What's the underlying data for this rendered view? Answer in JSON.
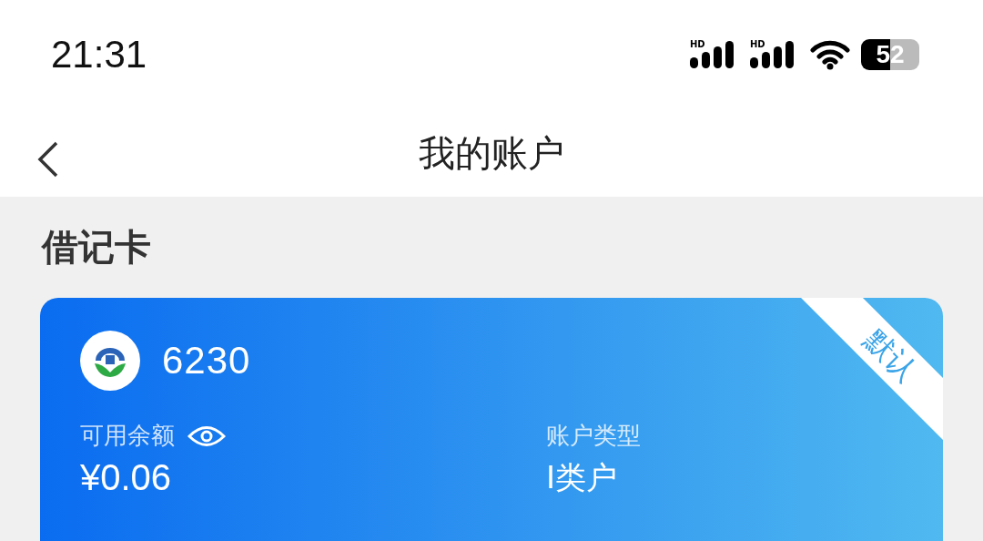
{
  "status_bar": {
    "time": "21:31",
    "signals": [
      {
        "label": "HD"
      },
      {
        "label": "HD"
      }
    ],
    "battery": "52"
  },
  "nav": {
    "title": "我的账户"
  },
  "section": {
    "title": "借记卡"
  },
  "card": {
    "number": "6230",
    "ribbon": "默认",
    "balance_label": "可用余额",
    "balance": "¥0.06",
    "type_label": "账户类型",
    "type": "I类户"
  }
}
